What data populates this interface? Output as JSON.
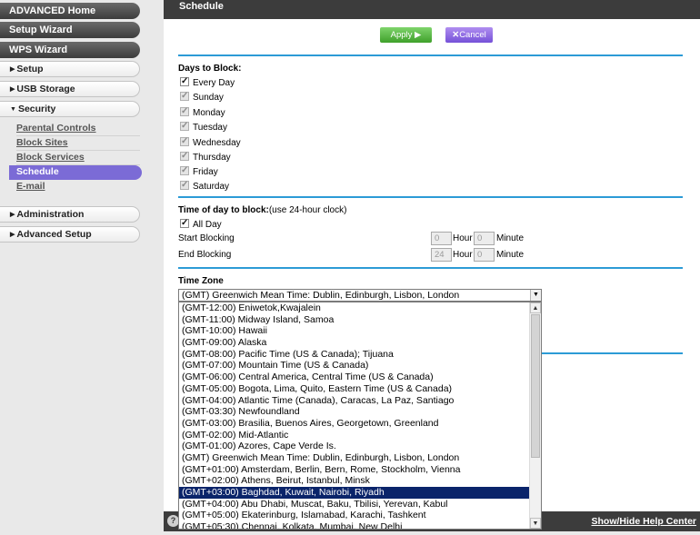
{
  "sidebar": {
    "advanced_home": "ADVANCED Home",
    "setup_wizard": "Setup Wizard",
    "wps_wizard": "WPS Wizard",
    "setup": "Setup",
    "usb_storage": "USB Storage",
    "security": "Security",
    "security_items": [
      "Parental Controls",
      "Block Sites",
      "Block Services",
      "Schedule",
      "E-mail"
    ],
    "administration": "Administration",
    "advanced_setup": "Advanced Setup"
  },
  "header": {
    "title": "Schedule"
  },
  "toolbar": {
    "apply_label": "Apply ▶",
    "cancel_label": "Cancel"
  },
  "days": {
    "title": "Days to Block:",
    "every_day": "Every Day",
    "list": [
      "Sunday",
      "Monday",
      "Tuesday",
      "Wednesday",
      "Thursday",
      "Friday",
      "Saturday"
    ]
  },
  "time": {
    "title": "Time of day to block:",
    "title_note": "(use 24-hour clock)",
    "all_day": "All Day",
    "start_label": "Start Blocking",
    "end_label": "End Blocking",
    "start_hour": "0",
    "start_minute": "0",
    "end_hour": "24",
    "end_minute": "0",
    "hour_label": "Hour",
    "minute_label": "Minute"
  },
  "timezone": {
    "title": "Time Zone",
    "selected": "(GMT) Greenwich Mean Time: Dublin, Edinburgh, Lisbon, London",
    "options": [
      "(GMT-12:00) Eniwetok,Kwajalein",
      "(GMT-11:00) Midway Island, Samoa",
      "(GMT-10:00) Hawaii",
      "(GMT-09:00) Alaska",
      "(GMT-08:00) Pacific Time (US & Canada); Tijuana",
      "(GMT-07:00) Mountain Time (US & Canada)",
      "(GMT-06:00) Central America, Central Time (US & Canada)",
      "(GMT-05:00) Bogota, Lima, Quito, Eastern Time (US & Canada)",
      "(GMT-04:00) Atlantic Time (Canada), Caracas, La Paz, Santiago",
      "(GMT-03:30) Newfoundland",
      "(GMT-03:00) Brasilia, Buenos Aires, Georgetown, Greenland",
      "(GMT-02:00) Mid-Atlantic",
      "(GMT-01:00) Azores, Cape Verde Is.",
      "(GMT) Greenwich Mean Time: Dublin, Edinburgh, Lisbon, London",
      "(GMT+01:00) Amsterdam, Berlin, Bern, Rome, Stockholm, Vienna",
      "(GMT+02:00) Athens, Beirut, Istanbul, Minsk",
      "(GMT+03:00) Baghdad, Kuwait, Nairobi, Riyadh",
      "(GMT+04:00) Abu Dhabi, Muscat, Baku, Tbilisi, Yerevan, Kabul",
      "(GMT+05:00) Ekaterinburg, Islamabad, Karachi, Tashkent",
      "(GMT+05:30) Chennai, Kolkata, Mumbai, New Delhi"
    ],
    "highlighted_index": 16
  },
  "footer": {
    "help_toggle": "Show/Hide Help Center"
  }
}
